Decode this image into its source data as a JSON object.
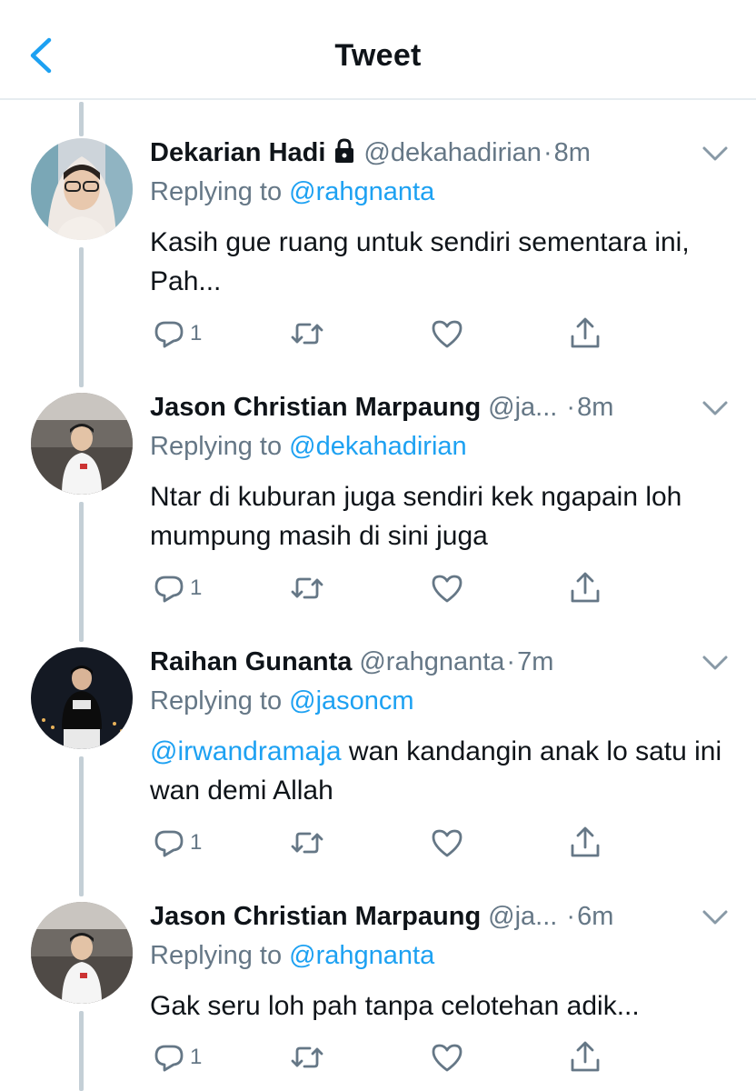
{
  "header": {
    "title": "Tweet"
  },
  "tweets": [
    {
      "name": "Dekarian Hadi",
      "handle": "@dekahadirian",
      "sep": "·",
      "time": "8m",
      "replying_prefix": "Replying to",
      "replying_to": "@rahgnanta",
      "text": "Kasih gue ruang untuk sendiri sementara ini, Pah...",
      "reply_count": "1"
    },
    {
      "name": "Jason Christian Marpaung",
      "handle": "@ja...",
      "sep": "·",
      "time": "8m",
      "replying_prefix": "Replying to",
      "replying_to": "@dekahadirian",
      "text": "Ntar di kuburan juga sendiri kek ngapain loh mumpung masih di sini juga",
      "reply_count": "1"
    },
    {
      "name": "Raihan Gunanta",
      "handle": "@rahgnanta",
      "sep": "·",
      "time": "7m",
      "replying_prefix": "Replying to",
      "replying_to": "@jasoncm",
      "text_mention": "@irwandramaja",
      "text": " wan kandangin anak lo satu ini wan demi Allah",
      "reply_count": "1"
    },
    {
      "name": "Jason Christian Marpaung",
      "handle": "@ja...",
      "sep": "·",
      "time": "6m",
      "replying_prefix": "Replying to",
      "replying_to": "@rahgnanta",
      "text": "Gak seru loh pah tanpa celotehan adik...",
      "reply_count": "1"
    }
  ],
  "icons": {
    "back": "chevron-left-icon",
    "lock": "lock-icon",
    "caret": "chevron-down-icon",
    "reply": "reply-icon",
    "retweet": "retweet-icon",
    "like": "heart-icon",
    "share": "share-icon"
  },
  "colors": {
    "accent": "#1da1f2",
    "secondary_text": "#657786",
    "thread_line": "#c4cfd6"
  }
}
